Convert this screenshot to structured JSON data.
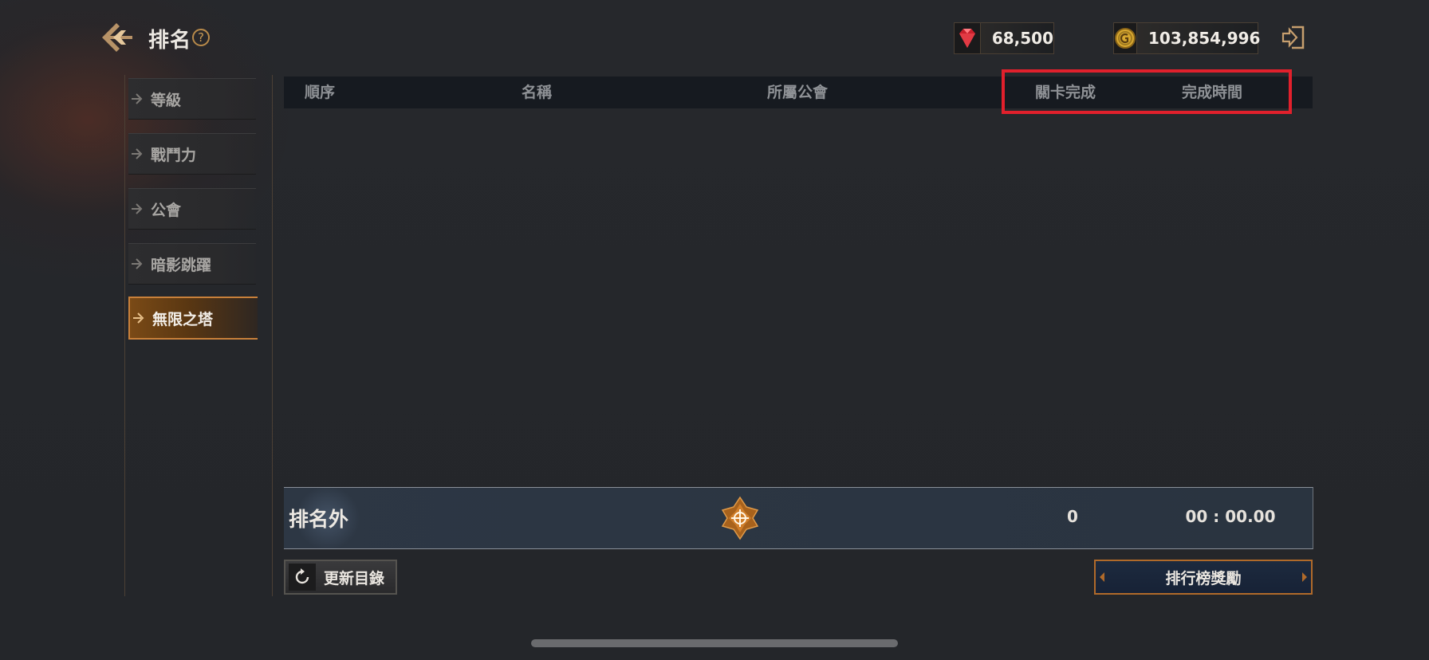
{
  "header": {
    "title": "排名",
    "help": "?"
  },
  "currencies": {
    "gem": {
      "icon": "ruby-gem-icon",
      "value": "68,500"
    },
    "gold": {
      "icon": "gold-coin-icon",
      "value": "103,854,996"
    }
  },
  "sidebar": {
    "items": [
      {
        "label": "等級",
        "active": false
      },
      {
        "label": "戰鬥力",
        "active": false
      },
      {
        "label": "公會",
        "active": false
      },
      {
        "label": "暗影跳躍",
        "active": false
      },
      {
        "label": "無限之塔",
        "active": true
      }
    ]
  },
  "table": {
    "columns": [
      "順序",
      "名稱",
      "所屬公會",
      "關卡完成",
      "完成時間"
    ],
    "rows": []
  },
  "my_rank": {
    "rank": "排名外",
    "stage": "0",
    "time": "00 : 00.00"
  },
  "buttons": {
    "refresh": "更新目錄",
    "rewards": "排行榜獎勵"
  },
  "colors": {
    "accent": "#c8803a",
    "highlight": "#e1202c",
    "background": "#24262a"
  }
}
